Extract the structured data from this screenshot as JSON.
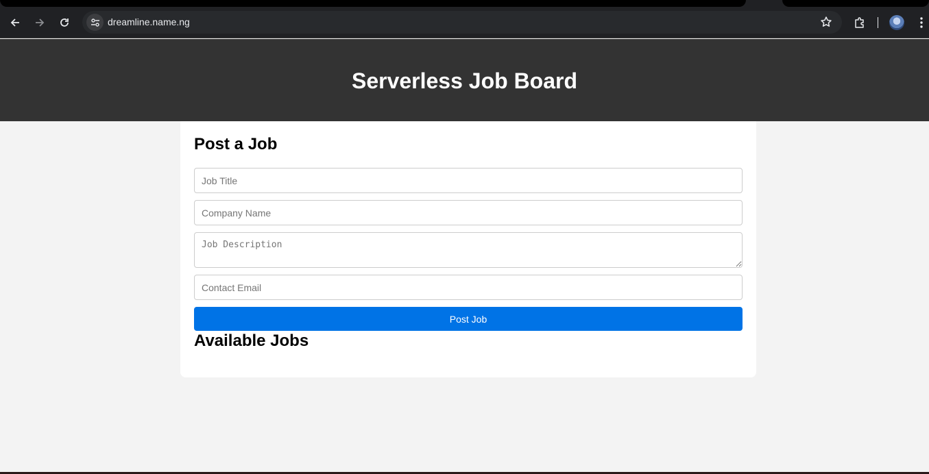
{
  "browser": {
    "url": "dreamline.name.ng"
  },
  "header": {
    "title": "Serverless Job Board"
  },
  "form": {
    "heading": "Post a Job",
    "job_title_placeholder": "Job Title",
    "company_name_placeholder": "Company Name",
    "job_description_placeholder": "Job Description",
    "contact_email_placeholder": "Contact Email",
    "submit_label": "Post Job"
  },
  "jobs": {
    "heading": "Available Jobs"
  },
  "colors": {
    "header_bg": "#333333",
    "page_bg": "#f3f3f3",
    "button_bg": "#0073e6"
  },
  "icons": [
    "back-arrow-icon",
    "forward-arrow-icon",
    "reload-icon",
    "site-info-icon",
    "bookmark-star-icon",
    "extensions-icon",
    "profile-avatar",
    "more-menu-icon"
  ]
}
